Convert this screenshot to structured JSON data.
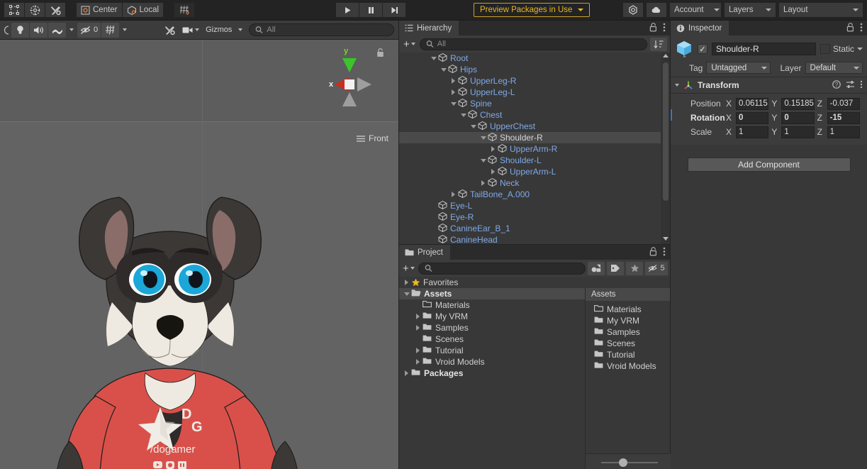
{
  "toolbar": {
    "tools": [
      {
        "name": "rect-transform-tool",
        "icon": "rect-tool-icon"
      },
      {
        "name": "custom-tool",
        "icon": "orbit-icon"
      },
      {
        "name": "editor-tools",
        "icon": "wrench-icon"
      }
    ],
    "pivot_label": "Center",
    "space_label": "Local",
    "snap_label": "",
    "play_label": "▶",
    "pause_label": "❚❚",
    "step_label": "▶▌",
    "preview_packages": "Preview Packages in Use",
    "cloud_label": "",
    "account_label": "Account",
    "layers_label": "Layers",
    "layout_label": "Layout"
  },
  "scene": {
    "toolbar": {
      "shading_label": "",
      "twod_label": "",
      "light_label": "",
      "audio_label": "",
      "fx_label": "",
      "hidden_count": "0",
      "grid_label": "",
      "component_tools_label": "",
      "camera_label": "",
      "gizmos_label": "Gizmos",
      "search_placeholder": "All"
    },
    "gizmo": {
      "axis_x": "x",
      "axis_y": "y",
      "view_label": "Front",
      "lock_icon": "lock-icon"
    }
  },
  "hierarchy": {
    "tab_label": "Hierarchy",
    "add_label": "+",
    "search_placeholder": "All",
    "sort_icon": "sort-icon",
    "lock_icon": "lock-icon",
    "menu_icon": "kebab-menu-icon",
    "rows": [
      {
        "label": "Root",
        "depth": 2,
        "expander": "down",
        "selected": false
      },
      {
        "label": "Hips",
        "depth": 3,
        "expander": "down",
        "selected": false
      },
      {
        "label": "UpperLeg-R",
        "depth": 4,
        "expander": "right",
        "selected": false
      },
      {
        "label": "UpperLeg-L",
        "depth": 4,
        "expander": "right",
        "selected": false
      },
      {
        "label": "Spine",
        "depth": 4,
        "expander": "down",
        "selected": false
      },
      {
        "label": "Chest",
        "depth": 5,
        "expander": "down",
        "selected": false
      },
      {
        "label": "UpperChest",
        "depth": 6,
        "expander": "down",
        "selected": false
      },
      {
        "label": "Shoulder-R",
        "depth": 7,
        "expander": "down",
        "selected": true
      },
      {
        "label": "UpperArm-R",
        "depth": 8,
        "expander": "right",
        "selected": false
      },
      {
        "label": "Shoulder-L",
        "depth": 7,
        "expander": "down",
        "selected": false
      },
      {
        "label": "UpperArm-L",
        "depth": 8,
        "expander": "right",
        "selected": false
      },
      {
        "label": "Neck",
        "depth": 7,
        "expander": "right",
        "selected": false
      },
      {
        "label": "TailBone_A.000",
        "depth": 4,
        "expander": "right",
        "selected": false
      },
      {
        "label": "Eye-L",
        "depth": 2,
        "expander": "none",
        "selected": false
      },
      {
        "label": "Eye-R",
        "depth": 2,
        "expander": "none",
        "selected": false
      },
      {
        "label": "CanineEar_B_1",
        "depth": 2,
        "expander": "none",
        "selected": false
      },
      {
        "label": "CanineHead",
        "depth": 2,
        "expander": "none",
        "selected": false
      }
    ]
  },
  "inspector": {
    "tab_label": "Inspector",
    "lock_icon": "lock-icon",
    "menu_icon": "kebab-menu-icon",
    "enabled_checked": true,
    "object_name": "Shoulder-R",
    "static_label": "Static",
    "tag_label": "Tag",
    "tag_value": "Untagged",
    "layer_label": "Layer",
    "layer_value": "Default",
    "transform": {
      "title": "Transform",
      "help_icon": "help-icon",
      "preset_icon": "preset-icon",
      "menu_icon": "kebab-menu-icon",
      "rows": [
        {
          "label": "Position",
          "bold": false,
          "x": "0.06115",
          "y": "0.15185",
          "z": "-0.037"
        },
        {
          "label": "Rotation",
          "bold": true,
          "x": "0",
          "y": "0",
          "z": "-15"
        },
        {
          "label": "Scale",
          "bold": false,
          "x": "1",
          "y": "1",
          "z": "1"
        }
      ],
      "axes": [
        "X",
        "Y",
        "Z"
      ]
    },
    "add_component_label": "Add Component"
  },
  "project": {
    "tab_label": "Project",
    "add_label": "+",
    "search_placeholder": "",
    "lock_icon": "lock-icon",
    "menu_icon": "kebab-menu-icon",
    "filter_icons": [
      "type-filter-icon",
      "label-filter-icon",
      "favorite-star-icon"
    ],
    "hidden_count": "5",
    "favorites_label": "Favorites",
    "tree": [
      {
        "label": "Assets",
        "depth": 0,
        "expander": "down",
        "bold": true,
        "selected": true,
        "folder": "open"
      },
      {
        "label": "Materials",
        "depth": 1,
        "expander": "none",
        "bold": false,
        "selected": false,
        "folder": "empty"
      },
      {
        "label": "My VRM",
        "depth": 1,
        "expander": "right",
        "bold": false,
        "selected": false,
        "folder": "filled"
      },
      {
        "label": "Samples",
        "depth": 1,
        "expander": "right",
        "bold": false,
        "selected": false,
        "folder": "filled"
      },
      {
        "label": "Scenes",
        "depth": 1,
        "expander": "none",
        "bold": false,
        "selected": false,
        "folder": "filled"
      },
      {
        "label": "Tutorial",
        "depth": 1,
        "expander": "right",
        "bold": false,
        "selected": false,
        "folder": "filled"
      },
      {
        "label": "Vroid Models",
        "depth": 1,
        "expander": "right",
        "bold": false,
        "selected": false,
        "folder": "filled"
      },
      {
        "label": "Packages",
        "depth": 0,
        "expander": "right",
        "bold": true,
        "selected": false,
        "folder": "filled"
      }
    ],
    "content_header": "Assets",
    "content_items": [
      {
        "label": "Materials",
        "folder": "empty"
      },
      {
        "label": "My VRM",
        "folder": "filled"
      },
      {
        "label": "Samples",
        "folder": "filled"
      },
      {
        "label": "Scenes",
        "folder": "filled"
      },
      {
        "label": "Tutorial",
        "folder": "filled"
      },
      {
        "label": "Vroid Models",
        "folder": "filled"
      }
    ],
    "zoom_slider_value": "30"
  },
  "character": {
    "shirt_color": "#d9504a",
    "shirt_brand": "/dogamer",
    "shirt_initials_d": "D",
    "shirt_initials_g": "G",
    "social_icons": [
      "youtube-icon",
      "instagram-icon",
      "twitch-icon"
    ],
    "fur_dark": "#3b3836",
    "fur_light": "#ece7de",
    "eye_color": "#1ba7d8"
  },
  "colors": {
    "accent_yellow": "#e8b923",
    "selection_blue": "#7fa9e8",
    "panel_bg": "#383838",
    "toolbar_bg": "#232323"
  }
}
